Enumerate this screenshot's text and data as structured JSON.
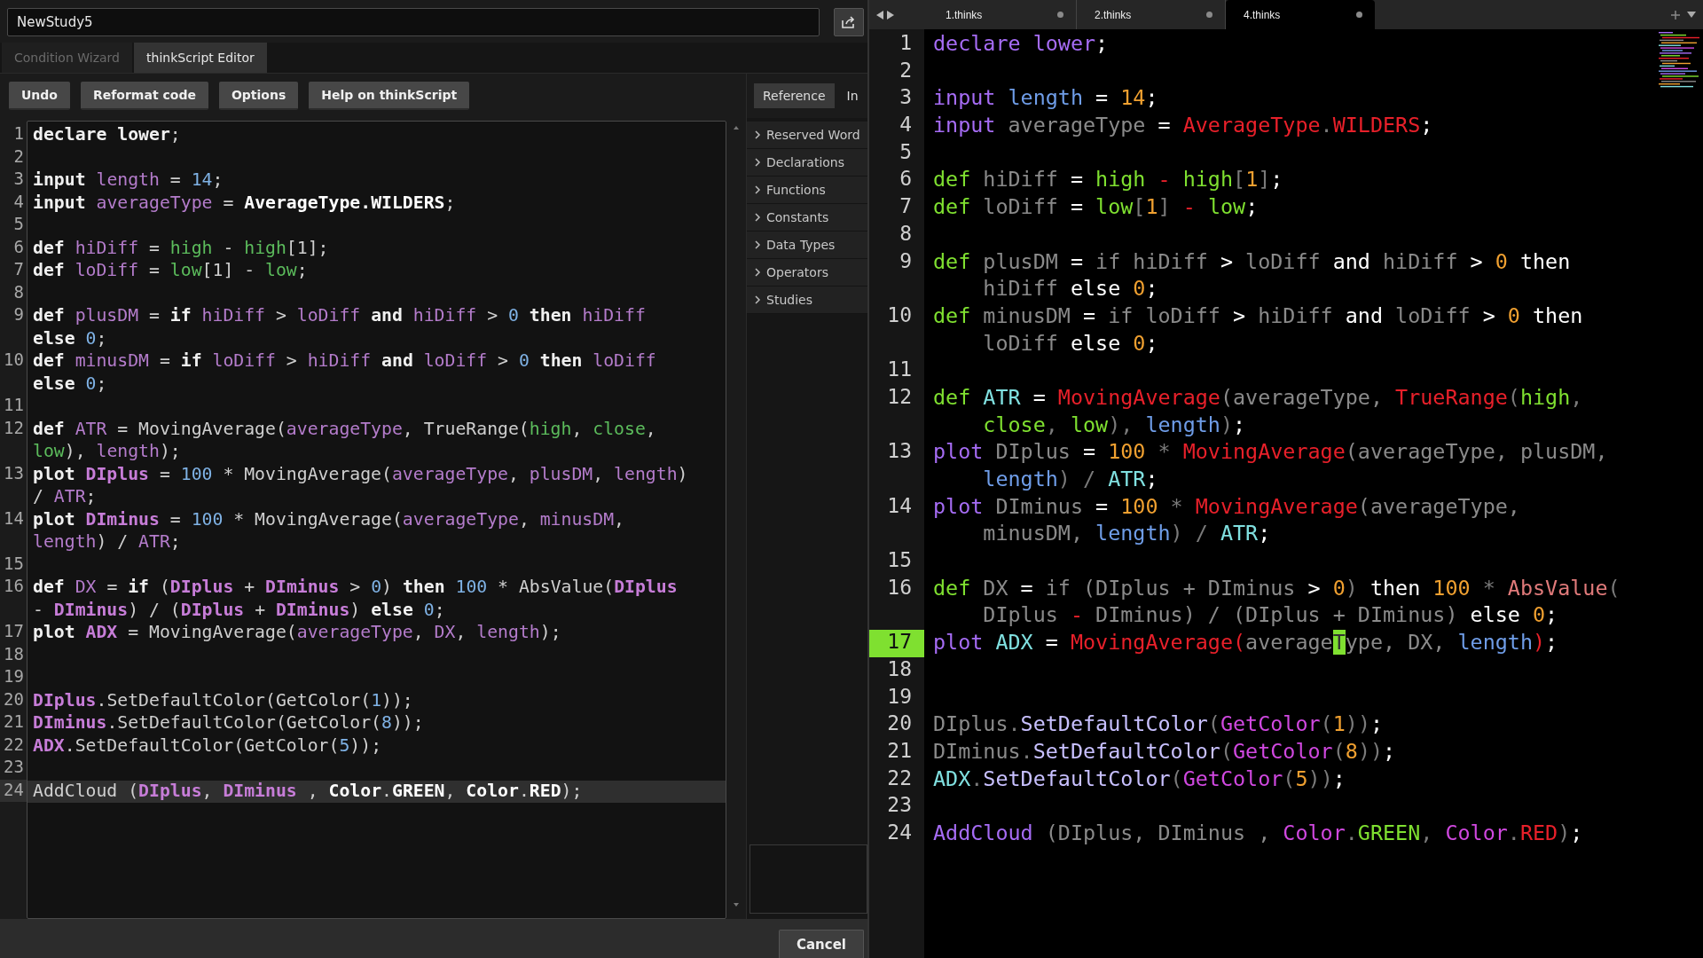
{
  "left": {
    "name_field": {
      "value": "NewStudy5"
    },
    "tabs": [
      {
        "label": "Condition Wizard",
        "selected": false
      },
      {
        "label": "thinkScript Editor",
        "selected": true
      }
    ],
    "toolbar": [
      "Undo",
      "Reformat code",
      "Options",
      "Help on thinkScript"
    ],
    "side_tabs": [
      {
        "label": "Reference",
        "selected": true
      },
      {
        "label": "In",
        "selected": false
      }
    ],
    "reference": [
      "Reserved Word",
      "Declarations",
      "Functions",
      "Constants",
      "Data Types",
      "Operators",
      "Studies"
    ],
    "lines": [
      {
        "number": "1",
        "current": false,
        "tokens": [
          {
            "text": "declare lower",
            "kind": "keyword"
          },
          {
            "text": ";",
            "kind": "plain"
          }
        ]
      },
      {
        "number": "2",
        "current": false
      },
      {
        "number": "3",
        "current": false,
        "tokens": [
          {
            "text": "input ",
            "kind": "keyword"
          },
          {
            "text": "length",
            "kind": "variable"
          },
          {
            "text": " = ",
            "kind": "plain"
          },
          {
            "text": "14",
            "kind": "number"
          },
          {
            "text": ";",
            "kind": "plain"
          }
        ]
      },
      {
        "number": "4",
        "current": false,
        "tokens": [
          {
            "text": "input ",
            "kind": "keyword"
          },
          {
            "text": "averageType",
            "kind": "variable"
          },
          {
            "text": " = ",
            "kind": "plain"
          },
          {
            "text": "AverageType.WILDERS",
            "kind": "constant"
          },
          {
            "text": ";",
            "kind": "plain"
          }
        ]
      },
      {
        "number": "5",
        "current": false
      },
      {
        "number": "6",
        "current": false,
        "tokens": [
          {
            "text": "def ",
            "kind": "keyword"
          },
          {
            "text": "hiDiff",
            "kind": "variable"
          },
          {
            "text": " = ",
            "kind": "plain"
          },
          {
            "text": "high",
            "kind": "builtin"
          },
          {
            "text": " - ",
            "kind": "plain"
          },
          {
            "text": "high",
            "kind": "builtin"
          },
          {
            "text": "[1];",
            "kind": "plain"
          }
        ]
      },
      {
        "number": "7",
        "current": false,
        "tokens": [
          {
            "text": "def ",
            "kind": "keyword"
          },
          {
            "text": "loDiff",
            "kind": "variable"
          },
          {
            "text": " = ",
            "kind": "plain"
          },
          {
            "text": "low",
            "kind": "builtin"
          },
          {
            "text": "[1] - ",
            "kind": "plain"
          },
          {
            "text": "low",
            "kind": "builtin"
          },
          {
            "text": ";",
            "kind": "plain"
          }
        ]
      },
      {
        "number": "8",
        "current": false
      },
      {
        "number": "9",
        "current": false,
        "tokens": [
          {
            "text": "def ",
            "kind": "keyword"
          },
          {
            "text": "plusDM",
            "kind": "variable"
          },
          {
            "text": " = ",
            "kind": "plain"
          },
          {
            "text": "if ",
            "kind": "keyword"
          },
          {
            "text": "hiDiff",
            "kind": "variable"
          },
          {
            "text": " > ",
            "kind": "plain"
          },
          {
            "text": "loDiff",
            "kind": "variable"
          },
          {
            "text": " and ",
            "kind": "keyword"
          },
          {
            "text": "hiDiff",
            "kind": "variable"
          },
          {
            "text": " > ",
            "kind": "plain"
          },
          {
            "text": "0",
            "kind": "number"
          },
          {
            "text": " then ",
            "kind": "keyword"
          },
          {
            "text": "hiDiff",
            "kind": "variable"
          }
        ],
        "continuation": [
          {
            "text": "else ",
            "kind": "keyword"
          },
          {
            "text": "0",
            "kind": "number"
          },
          {
            "text": ";",
            "kind": "plain"
          }
        ]
      },
      {
        "number": "10",
        "current": false,
        "tokens": [
          {
            "text": "def ",
            "kind": "keyword"
          },
          {
            "text": "minusDM",
            "kind": "variable"
          },
          {
            "text": " = ",
            "kind": "plain"
          },
          {
            "text": "if ",
            "kind": "keyword"
          },
          {
            "text": "loDiff",
            "kind": "variable"
          },
          {
            "text": " > ",
            "kind": "plain"
          },
          {
            "text": "hiDiff",
            "kind": "variable"
          },
          {
            "text": " and ",
            "kind": "keyword"
          },
          {
            "text": "loDiff",
            "kind": "variable"
          },
          {
            "text": " > ",
            "kind": "plain"
          },
          {
            "text": "0",
            "kind": "number"
          },
          {
            "text": " then ",
            "kind": "keyword"
          },
          {
            "text": "loDiff",
            "kind": "variable"
          }
        ],
        "continuation": [
          {
            "text": "else ",
            "kind": "keyword"
          },
          {
            "text": "0",
            "kind": "number"
          },
          {
            "text": ";",
            "kind": "plain"
          }
        ]
      },
      {
        "number": "11",
        "current": false
      },
      {
        "number": "12",
        "current": false,
        "tokens": [
          {
            "text": "def ",
            "kind": "keyword"
          },
          {
            "text": "ATR",
            "kind": "variable"
          },
          {
            "text": " = MovingAverage(",
            "kind": "plain"
          },
          {
            "text": "averageType",
            "kind": "variable"
          },
          {
            "text": ", TrueRange(",
            "kind": "plain"
          },
          {
            "text": "high",
            "kind": "builtin"
          },
          {
            "text": ", ",
            "kind": "plain"
          },
          {
            "text": "close",
            "kind": "builtin"
          },
          {
            "text": ",",
            "kind": "plain"
          }
        ],
        "continuation": [
          {
            "text": "low",
            "kind": "builtin"
          },
          {
            "text": "), ",
            "kind": "plain"
          },
          {
            "text": "length",
            "kind": "variable"
          },
          {
            "text": ");",
            "kind": "plain"
          }
        ]
      },
      {
        "number": "13",
        "current": false,
        "tokens": [
          {
            "text": "plot ",
            "kind": "keyword"
          },
          {
            "text": "DIplus",
            "kind": "plot"
          },
          {
            "text": " = ",
            "kind": "plain"
          },
          {
            "text": "100",
            "kind": "number"
          },
          {
            "text": " * MovingAverage(",
            "kind": "plain"
          },
          {
            "text": "averageType",
            "kind": "variable"
          },
          {
            "text": ", ",
            "kind": "plain"
          },
          {
            "text": "plusDM",
            "kind": "variable"
          },
          {
            "text": ", ",
            "kind": "plain"
          },
          {
            "text": "length",
            "kind": "variable"
          },
          {
            "text": ")",
            "kind": "plain"
          }
        ],
        "continuation": [
          {
            "text": "/ ",
            "kind": "plain"
          },
          {
            "text": "ATR",
            "kind": "variable"
          },
          {
            "text": ";",
            "kind": "plain"
          }
        ]
      },
      {
        "number": "14",
        "current": false,
        "tokens": [
          {
            "text": "plot ",
            "kind": "keyword"
          },
          {
            "text": "DIminus",
            "kind": "plot"
          },
          {
            "text": " = ",
            "kind": "plain"
          },
          {
            "text": "100",
            "kind": "number"
          },
          {
            "text": " * MovingAverage(",
            "kind": "plain"
          },
          {
            "text": "averageType",
            "kind": "variable"
          },
          {
            "text": ", ",
            "kind": "plain"
          },
          {
            "text": "minusDM",
            "kind": "variable"
          },
          {
            "text": ",",
            "kind": "plain"
          }
        ],
        "continuation": [
          {
            "text": "length",
            "kind": "variable"
          },
          {
            "text": ") / ",
            "kind": "plain"
          },
          {
            "text": "ATR",
            "kind": "variable"
          },
          {
            "text": ";",
            "kind": "plain"
          }
        ]
      },
      {
        "number": "15",
        "current": false
      },
      {
        "number": "16",
        "current": false,
        "tokens": [
          {
            "text": "def ",
            "kind": "keyword"
          },
          {
            "text": "DX",
            "kind": "variable"
          },
          {
            "text": " = ",
            "kind": "plain"
          },
          {
            "text": "if",
            "kind": "keyword"
          },
          {
            "text": " (",
            "kind": "plain"
          },
          {
            "text": "DIplus",
            "kind": "plot"
          },
          {
            "text": " + ",
            "kind": "plain"
          },
          {
            "text": "DIminus",
            "kind": "plot"
          },
          {
            "text": " > ",
            "kind": "plain"
          },
          {
            "text": "0",
            "kind": "number"
          },
          {
            "text": ") ",
            "kind": "plain"
          },
          {
            "text": "then ",
            "kind": "keyword"
          },
          {
            "text": "100",
            "kind": "number"
          },
          {
            "text": " * AbsValue(",
            "kind": "plain"
          },
          {
            "text": "DIplus",
            "kind": "plot"
          }
        ],
        "continuation": [
          {
            "text": "- ",
            "kind": "plain"
          },
          {
            "text": "DIminus",
            "kind": "plot"
          },
          {
            "text": ") / (",
            "kind": "plain"
          },
          {
            "text": "DIplus",
            "kind": "plot"
          },
          {
            "text": " + ",
            "kind": "plain"
          },
          {
            "text": "DIminus",
            "kind": "plot"
          },
          {
            "text": ") ",
            "kind": "plain"
          },
          {
            "text": "else ",
            "kind": "keyword"
          },
          {
            "text": "0",
            "kind": "number"
          },
          {
            "text": ";",
            "kind": "plain"
          }
        ]
      },
      {
        "number": "17",
        "current": false,
        "tokens": [
          {
            "text": "plot ",
            "kind": "keyword"
          },
          {
            "text": "ADX",
            "kind": "plot"
          },
          {
            "text": " = MovingAverage(",
            "kind": "plain"
          },
          {
            "text": "averageType",
            "kind": "variable"
          },
          {
            "text": ", ",
            "kind": "plain"
          },
          {
            "text": "DX",
            "kind": "variable"
          },
          {
            "text": ", ",
            "kind": "plain"
          },
          {
            "text": "length",
            "kind": "variable"
          },
          {
            "text": ");",
            "kind": "plain"
          }
        ]
      },
      {
        "number": "18",
        "current": false
      },
      {
        "number": "19",
        "current": false
      },
      {
        "number": "20",
        "current": false,
        "tokens": [
          {
            "text": "DIplus",
            "kind": "plot"
          },
          {
            "text": ".SetDefaultColor(GetColor(",
            "kind": "plain"
          },
          {
            "text": "1",
            "kind": "number"
          },
          {
            "text": "));",
            "kind": "plain"
          }
        ]
      },
      {
        "number": "21",
        "current": false,
        "tokens": [
          {
            "text": "DIminus",
            "kind": "plot"
          },
          {
            "text": ".SetDefaultColor(GetColor(",
            "kind": "plain"
          },
          {
            "text": "8",
            "kind": "number"
          },
          {
            "text": "));",
            "kind": "plain"
          }
        ]
      },
      {
        "number": "22",
        "current": false,
        "tokens": [
          {
            "text": "ADX",
            "kind": "plot"
          },
          {
            "text": ".SetDefaultColor(GetColor(",
            "kind": "plain"
          },
          {
            "text": "5",
            "kind": "number"
          },
          {
            "text": "));",
            "kind": "plain"
          }
        ]
      },
      {
        "number": "23",
        "current": false
      },
      {
        "number": "24",
        "current": true,
        "tokens": [
          {
            "text": "AddCloud (",
            "kind": "plain"
          },
          {
            "text": "DIplus",
            "kind": "plot"
          },
          {
            "text": ", ",
            "kind": "plain"
          },
          {
            "text": "DIminus",
            "kind": "plot"
          },
          {
            "text": " , ",
            "kind": "plain"
          },
          {
            "text": "Color",
            "kind": "constant"
          },
          {
            "text": ".",
            "kind": "plain"
          },
          {
            "text": "GREEN",
            "kind": "constant"
          },
          {
            "text": ", ",
            "kind": "plain"
          },
          {
            "text": "Color",
            "kind": "constant"
          },
          {
            "text": ".",
            "kind": "plain"
          },
          {
            "text": "RED",
            "kind": "constant"
          },
          {
            "text": ");",
            "kind": "plain"
          }
        ]
      }
    ],
    "footer_buttons": [
      "Cancel"
    ]
  },
  "right": {
    "tabs": [
      {
        "label": "1.thinks",
        "selected": false
      },
      {
        "label": "2.thinks",
        "selected": false
      },
      {
        "label": "4.thinks",
        "selected": true
      }
    ],
    "lines": [
      {
        "number": "1",
        "current": false,
        "tokens": [
          {
            "text": "declare lower",
            "kind": "keyword"
          },
          {
            "text": ";",
            "kind": "operator"
          }
        ]
      },
      {
        "number": "2",
        "current": false
      },
      {
        "number": "3",
        "current": false,
        "tokens": [
          {
            "text": "input ",
            "kind": "keyword"
          },
          {
            "text": "length",
            "kind": "parameter"
          },
          {
            "text": " = ",
            "kind": "operator"
          },
          {
            "text": "14",
            "kind": "number"
          },
          {
            "text": ";",
            "kind": "operator"
          }
        ]
      },
      {
        "number": "4",
        "current": false,
        "tokens": [
          {
            "text": "input ",
            "kind": "keyword"
          },
          {
            "text": "averageType",
            "kind": "variable"
          },
          {
            "text": " = ",
            "kind": "operator"
          },
          {
            "text": "AverageType",
            "kind": "function"
          },
          {
            "text": ".",
            "kind": "punctuation"
          },
          {
            "text": "WILDERS",
            "kind": "function"
          },
          {
            "text": ";",
            "kind": "operator"
          }
        ]
      },
      {
        "number": "5",
        "current": false
      },
      {
        "number": "6",
        "current": false,
        "tokens": [
          {
            "text": "def ",
            "kind": "builtin"
          },
          {
            "text": "hiDiff",
            "kind": "variable"
          },
          {
            "text": " = ",
            "kind": "operator"
          },
          {
            "text": "high",
            "kind": "builtin"
          },
          {
            "text": " - ",
            "kind": "function"
          },
          {
            "text": "high",
            "kind": "builtin"
          },
          {
            "text": "[",
            "kind": "punctuation"
          },
          {
            "text": "1",
            "kind": "number"
          },
          {
            "text": "]",
            "kind": "punctuation"
          },
          {
            "text": ";",
            "kind": "operator"
          }
        ]
      },
      {
        "number": "7",
        "current": false,
        "tokens": [
          {
            "text": "def ",
            "kind": "builtin"
          },
          {
            "text": "loDiff",
            "kind": "variable"
          },
          {
            "text": " = ",
            "kind": "operator"
          },
          {
            "text": "low",
            "kind": "builtin"
          },
          {
            "text": "[",
            "kind": "punctuation"
          },
          {
            "text": "1",
            "kind": "number"
          },
          {
            "text": "]",
            "kind": "punctuation"
          },
          {
            "text": " - ",
            "kind": "function"
          },
          {
            "text": "low",
            "kind": "builtin"
          },
          {
            "text": ";",
            "kind": "operator"
          }
        ]
      },
      {
        "number": "8",
        "current": false
      },
      {
        "number": "9",
        "current": false,
        "tokens": [
          {
            "text": "def ",
            "kind": "builtin"
          },
          {
            "text": "plusDM",
            "kind": "variable"
          },
          {
            "text": " = ",
            "kind": "operator"
          },
          {
            "text": "if hiDiff",
            "kind": "variable"
          },
          {
            "text": " > ",
            "kind": "operator"
          },
          {
            "text": "loDiff",
            "kind": "variable"
          },
          {
            "text": " and ",
            "kind": "operator"
          },
          {
            "text": "hiDiff",
            "kind": "variable"
          },
          {
            "text": " > ",
            "kind": "operator"
          },
          {
            "text": "0",
            "kind": "number"
          },
          {
            "text": " then",
            "kind": "operator"
          }
        ],
        "continuation": [
          {
            "text": "hiDiff",
            "kind": "variable"
          },
          {
            "text": " else ",
            "kind": "operator"
          },
          {
            "text": "0",
            "kind": "number"
          },
          {
            "text": ";",
            "kind": "operator"
          }
        ]
      },
      {
        "number": "10",
        "current": false,
        "tokens": [
          {
            "text": "def ",
            "kind": "builtin"
          },
          {
            "text": "minusDM",
            "kind": "variable"
          },
          {
            "text": " = ",
            "kind": "operator"
          },
          {
            "text": "if loDiff",
            "kind": "variable"
          },
          {
            "text": " > ",
            "kind": "operator"
          },
          {
            "text": "hiDiff",
            "kind": "variable"
          },
          {
            "text": " and ",
            "kind": "operator"
          },
          {
            "text": "loDiff",
            "kind": "variable"
          },
          {
            "text": " > ",
            "kind": "operator"
          },
          {
            "text": "0",
            "kind": "number"
          },
          {
            "text": " then",
            "kind": "operator"
          }
        ],
        "continuation": [
          {
            "text": "loDiff",
            "kind": "variable"
          },
          {
            "text": " else ",
            "kind": "operator"
          },
          {
            "text": "0",
            "kind": "number"
          },
          {
            "text": ";",
            "kind": "operator"
          }
        ]
      },
      {
        "number": "11",
        "current": false
      },
      {
        "number": "12",
        "current": false,
        "tokens": [
          {
            "text": "def ",
            "kind": "builtin"
          },
          {
            "text": "ATR",
            "kind": "plot"
          },
          {
            "text": " = ",
            "kind": "operator"
          },
          {
            "text": "MovingAverage",
            "kind": "function"
          },
          {
            "text": "(averageType, ",
            "kind": "variable"
          },
          {
            "text": "TrueRange",
            "kind": "function"
          },
          {
            "text": "(",
            "kind": "punctuation"
          },
          {
            "text": "high",
            "kind": "builtin"
          },
          {
            "text": ",",
            "kind": "punctuation"
          }
        ],
        "continuation": [
          {
            "text": "close",
            "kind": "builtin"
          },
          {
            "text": ", ",
            "kind": "punctuation"
          },
          {
            "text": "low",
            "kind": "builtin"
          },
          {
            "text": "), ",
            "kind": "punctuation"
          },
          {
            "text": "length",
            "kind": "parameter"
          },
          {
            "text": ")",
            "kind": "punctuation"
          },
          {
            "text": ";",
            "kind": "operator"
          }
        ]
      },
      {
        "number": "13",
        "current": false,
        "tokens": [
          {
            "text": "plot ",
            "kind": "keyword"
          },
          {
            "text": "DIplus ",
            "kind": "variable"
          },
          {
            "text": "= ",
            "kind": "operator"
          },
          {
            "text": "100",
            "kind": "number"
          },
          {
            "text": " * ",
            "kind": "punctuation"
          },
          {
            "text": "MovingAverage",
            "kind": "function"
          },
          {
            "text": "(averageType, plusDM,",
            "kind": "variable"
          }
        ],
        "continuation": [
          {
            "text": "length",
            "kind": "parameter"
          },
          {
            "text": ") / ",
            "kind": "punctuation"
          },
          {
            "text": "ATR",
            "kind": "plot"
          },
          {
            "text": ";",
            "kind": "operator"
          }
        ]
      },
      {
        "number": "14",
        "current": false,
        "tokens": [
          {
            "text": "plot ",
            "kind": "keyword"
          },
          {
            "text": "DIminus ",
            "kind": "variable"
          },
          {
            "text": "= ",
            "kind": "operator"
          },
          {
            "text": "100",
            "kind": "number"
          },
          {
            "text": " * ",
            "kind": "punctuation"
          },
          {
            "text": "MovingAverage",
            "kind": "function"
          },
          {
            "text": "(averageType,",
            "kind": "variable"
          }
        ],
        "continuation": [
          {
            "text": "minusDM, ",
            "kind": "variable"
          },
          {
            "text": "length",
            "kind": "parameter"
          },
          {
            "text": ") / ",
            "kind": "punctuation"
          },
          {
            "text": "ATR",
            "kind": "plot"
          },
          {
            "text": ";",
            "kind": "operator"
          }
        ]
      },
      {
        "number": "15",
        "current": false
      },
      {
        "number": "16",
        "current": false,
        "tokens": [
          {
            "text": "def ",
            "kind": "builtin"
          },
          {
            "text": "DX ",
            "kind": "variable"
          },
          {
            "text": "= ",
            "kind": "operator"
          },
          {
            "text": "if (DIplus + DIminus ",
            "kind": "variable"
          },
          {
            "text": "> ",
            "kind": "operator"
          },
          {
            "text": "0",
            "kind": "number"
          },
          {
            "text": ")",
            "kind": "punctuation"
          },
          {
            "text": " then ",
            "kind": "operator"
          },
          {
            "text": "100",
            "kind": "number"
          },
          {
            "text": " * ",
            "kind": "punctuation"
          },
          {
            "text": "AbsValue",
            "kind": "special"
          },
          {
            "text": "(",
            "kind": "punctuation"
          }
        ],
        "continuation": [
          {
            "text": "DIplus ",
            "kind": "variable"
          },
          {
            "text": "-",
            "kind": "function"
          },
          {
            "text": " DIminus) / (DIplus + DIminus) ",
            "kind": "variable"
          },
          {
            "text": "else ",
            "kind": "operator"
          },
          {
            "text": "0",
            "kind": "number"
          },
          {
            "text": ";",
            "kind": "operator"
          }
        ]
      },
      {
        "number": "17",
        "current": true,
        "tokens": [
          {
            "text": "plot ",
            "kind": "keyword"
          },
          {
            "text": "ADX",
            "kind": "plot"
          },
          {
            "text": " = ",
            "kind": "operator"
          },
          {
            "text": "MovingAverage",
            "kind": "function"
          },
          {
            "text": "(",
            "kind": "function"
          },
          {
            "text": "average",
            "kind": "variable"
          },
          {
            "text": "T",
            "kind": "cursor"
          },
          {
            "text": "ype, DX, ",
            "kind": "variable"
          },
          {
            "text": "length",
            "kind": "parameter"
          },
          {
            "text": ")",
            "kind": "function"
          },
          {
            "text": ";",
            "kind": "operator"
          }
        ]
      },
      {
        "number": "18",
        "current": false
      },
      {
        "number": "19",
        "current": false
      },
      {
        "number": "20",
        "current": false,
        "tokens": [
          {
            "text": "DIplus",
            "kind": "variable"
          },
          {
            "text": ".",
            "kind": "punctuation"
          },
          {
            "text": "SetDefaultColor",
            "kind": "method"
          },
          {
            "text": "(",
            "kind": "punctuation"
          },
          {
            "text": "GetColor",
            "kind": "call"
          },
          {
            "text": "(",
            "kind": "punctuation"
          },
          {
            "text": "1",
            "kind": "number"
          },
          {
            "text": "))",
            "kind": "punctuation"
          },
          {
            "text": ";",
            "kind": "operator"
          }
        ]
      },
      {
        "number": "21",
        "current": false,
        "tokens": [
          {
            "text": "DIminus",
            "kind": "variable"
          },
          {
            "text": ".",
            "kind": "punctuation"
          },
          {
            "text": "SetDefaultColor",
            "kind": "method"
          },
          {
            "text": "(",
            "kind": "punctuation"
          },
          {
            "text": "GetColor",
            "kind": "call"
          },
          {
            "text": "(",
            "kind": "punctuation"
          },
          {
            "text": "8",
            "kind": "number"
          },
          {
            "text": "))",
            "kind": "punctuation"
          },
          {
            "text": ";",
            "kind": "operator"
          }
        ]
      },
      {
        "number": "22",
        "current": false,
        "tokens": [
          {
            "text": "ADX",
            "kind": "plot"
          },
          {
            "text": ".",
            "kind": "punctuation"
          },
          {
            "text": "SetDefaultColor",
            "kind": "method"
          },
          {
            "text": "(",
            "kind": "punctuation"
          },
          {
            "text": "GetColor",
            "kind": "call"
          },
          {
            "text": "(",
            "kind": "punctuation"
          },
          {
            "text": "5",
            "kind": "number"
          },
          {
            "text": "))",
            "kind": "punctuation"
          },
          {
            "text": ";",
            "kind": "operator"
          }
        ]
      },
      {
        "number": "23",
        "current": false
      },
      {
        "number": "24",
        "current": false,
        "tokens": [
          {
            "text": "AddCloud",
            "kind": "keyword"
          },
          {
            "text": " (DIplus, DIminus , ",
            "kind": "variable"
          },
          {
            "text": "Color",
            "kind": "call"
          },
          {
            "text": ".",
            "kind": "punctuation"
          },
          {
            "text": "GREEN",
            "kind": "builtin"
          },
          {
            "text": ", ",
            "kind": "punctuation"
          },
          {
            "text": "Color",
            "kind": "call"
          },
          {
            "text": ".",
            "kind": "punctuation"
          },
          {
            "text": "RED",
            "kind": "function"
          },
          {
            "text": ")",
            "kind": "punctuation"
          },
          {
            "text": ";",
            "kind": "operator"
          }
        ]
      }
    ]
  }
}
